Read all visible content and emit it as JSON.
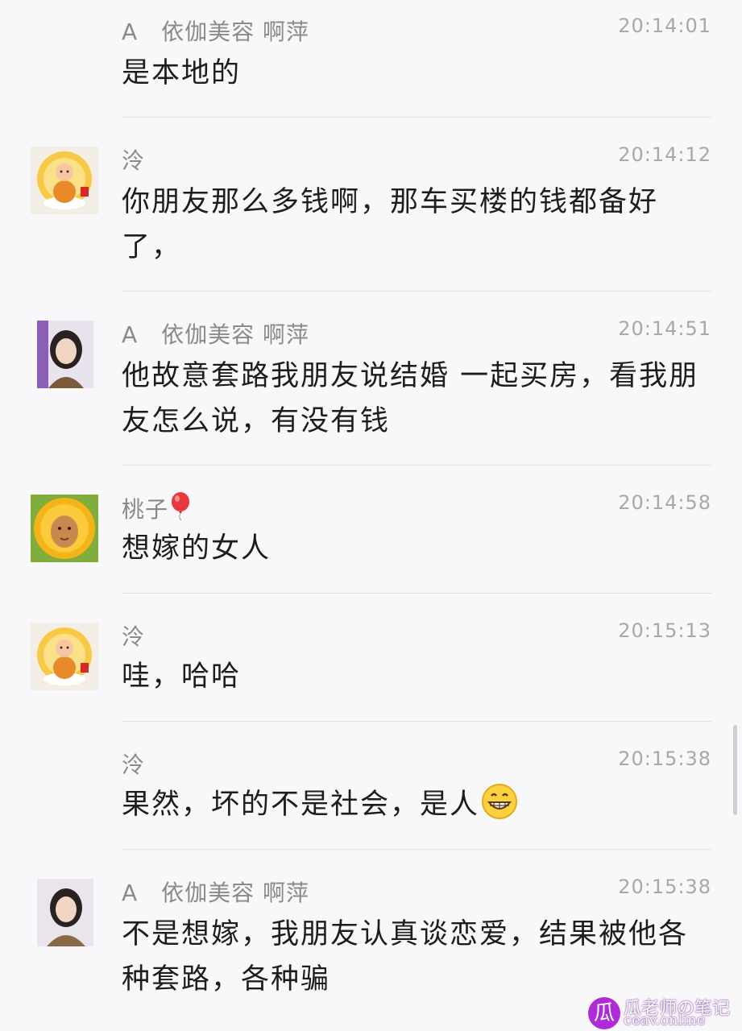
{
  "messages": [
    {
      "sender": "A　依伽美容 啊萍",
      "time": "20:14:01",
      "text": "是本地的",
      "avatar": null
    },
    {
      "sender": "泠",
      "time": "20:14:12",
      "text": "你朋友那么多钱啊，那车买楼的钱都备好了，",
      "avatar": "buddha-avatar-icon"
    },
    {
      "sender": "A　依伽美容 啊萍",
      "time": "20:14:51",
      "text": "他故意套路我朋友说结婚 一起买房，看我朋友怎么说，有没有钱",
      "avatar": "woman-avatar-icon"
    },
    {
      "sender": "桃子",
      "time": "20:14:58",
      "text": "想嫁的女人",
      "avatar": "sunflower-avatar-icon",
      "sender_emoji": "balloon-icon"
    },
    {
      "sender": "泠",
      "time": "20:15:13",
      "text": "哇，哈哈",
      "avatar": "buddha-avatar-icon"
    },
    {
      "sender": "泠",
      "time": "20:15:38",
      "text": "果然，坏的不是社会，是人",
      "avatar": null,
      "text_emoji": "grin-icon"
    },
    {
      "sender": "A　依伽美容 啊萍",
      "time": "20:15:38",
      "text": "不是想嫁，我朋友认真谈恋爱，结果被他各种套路，各种骗",
      "avatar": "woman-avatar-icon"
    }
  ],
  "watermark": {
    "logo": "瓜",
    "title": "瓜老师の笔记",
    "domain": "ceav.online"
  },
  "colors": {
    "background": "#f8f7fa",
    "text": "#1d1d1d",
    "meta": "#8a8a8a",
    "divider": "#e3e2e6",
    "watermark": "#b02bd8"
  }
}
